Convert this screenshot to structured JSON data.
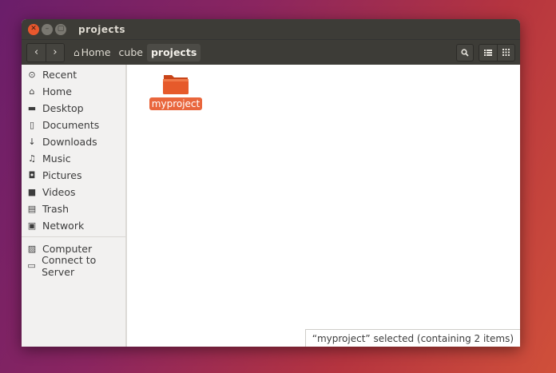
{
  "window": {
    "title": "projects",
    "controls": {
      "close": "✕",
      "minimize": "–",
      "maximize": "▢"
    }
  },
  "toolbar": {
    "back_icon": "‹",
    "forward_icon": "›",
    "breadcrumbs": [
      {
        "label": "Home",
        "icon": "⌂"
      },
      {
        "label": "cube"
      },
      {
        "label": "projects"
      }
    ],
    "search_icon": "search-icon",
    "view_list_icon": "list-icon",
    "view_grid_icon": "grid-icon"
  },
  "sidebar": {
    "places": [
      {
        "label": "Recent",
        "icon": "⊙"
      },
      {
        "label": "Home",
        "icon": "⌂"
      },
      {
        "label": "Desktop",
        "icon": "▬"
      },
      {
        "label": "Documents",
        "icon": "▯"
      },
      {
        "label": "Downloads",
        "icon": "↓"
      },
      {
        "label": "Music",
        "icon": "♫"
      },
      {
        "label": "Pictures",
        "icon": "◘"
      },
      {
        "label": "Videos",
        "icon": "■"
      },
      {
        "label": "Trash",
        "icon": "▤"
      },
      {
        "label": "Network",
        "icon": "▣"
      }
    ],
    "devices": [
      {
        "label": "Computer",
        "icon": "▨"
      },
      {
        "label": "Connect to Server",
        "icon": "▭"
      }
    ]
  },
  "content": {
    "items": [
      {
        "name": "myproject",
        "selected": true
      }
    ],
    "folder_color": "#e65a2b"
  },
  "status": {
    "text": "“myproject” selected  (containing 2 items)"
  },
  "colors": {
    "accent": "#e9663c",
    "titlebar": "#3d3c37",
    "sidebar_bg": "#f2f1f0"
  }
}
